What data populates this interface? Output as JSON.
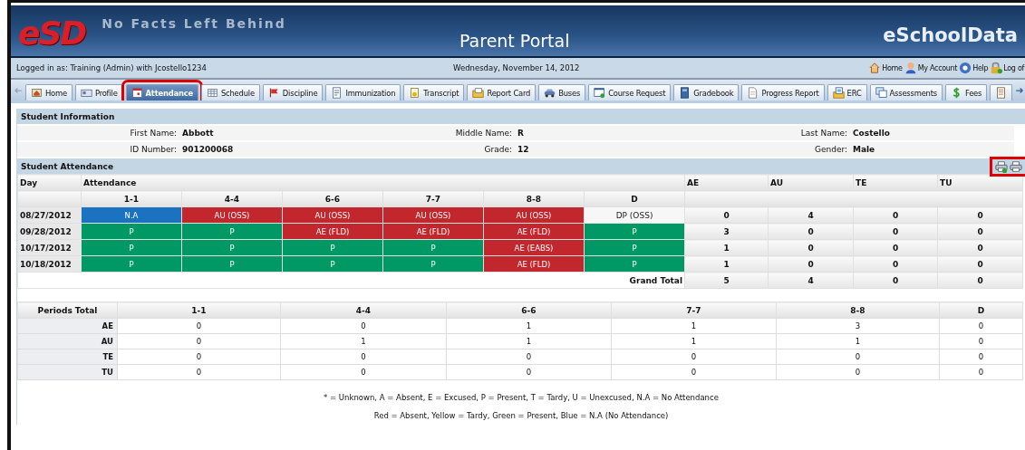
{
  "header": {
    "logo": "eSD",
    "tagline": "No Facts Left Behind",
    "title": "Parent Portal",
    "brand": "eSchoolData"
  },
  "info_bar": {
    "login": "Logged in as: Training (Admin) with Jcostello1234",
    "date": "Wednesday, November 14, 2012",
    "links": [
      "Home",
      "My Account",
      "Help",
      "Log of"
    ]
  },
  "tabs": [
    {
      "label": "Home",
      "selected": false,
      "highlighted": false
    },
    {
      "label": "Profile",
      "selected": false,
      "highlighted": false
    },
    {
      "label": "Attendance",
      "selected": true,
      "highlighted": true
    },
    {
      "label": "Schedule",
      "selected": false,
      "highlighted": false
    },
    {
      "label": "Discipline",
      "selected": false,
      "highlighted": false
    },
    {
      "label": "Immunization",
      "selected": false,
      "highlighted": false
    },
    {
      "label": "Transcript",
      "selected": false,
      "highlighted": false
    },
    {
      "label": "Report Card",
      "selected": false,
      "highlighted": false
    },
    {
      "label": "Buses",
      "selected": false,
      "highlighted": false
    },
    {
      "label": "Course Request",
      "selected": false,
      "highlighted": false
    },
    {
      "label": "Gradebook",
      "selected": false,
      "highlighted": false
    },
    {
      "label": "Progress Report",
      "selected": false,
      "highlighted": false
    },
    {
      "label": "ERC",
      "selected": false,
      "highlighted": false
    },
    {
      "label": "Assessments",
      "selected": false,
      "highlighted": false
    },
    {
      "label": "Fees",
      "selected": false,
      "highlighted": false
    },
    {
      "selected": false,
      "highlighted": false
    }
  ],
  "student_information": {
    "title": "Student Information",
    "fields": [
      {
        "label": "First Name:",
        "value": "Abbott"
      },
      {
        "label": "Middle Name:",
        "value": "R"
      },
      {
        "label": "Last Name:",
        "value": "Costello"
      },
      {
        "label": "ID Number:",
        "value": "901200068"
      },
      {
        "label": "Grade:",
        "value": "12"
      },
      {
        "label": "Gender:",
        "value": "Male"
      }
    ]
  },
  "student_attendance": {
    "title": "Student Attendance",
    "print_highlighted": true,
    "columns": {
      "day": "Day",
      "attendance": "Attendance",
      "periods": [
        "1-1",
        "4-4",
        "6-6",
        "7-7",
        "8-8",
        "D"
      ],
      "totals": [
        "AE",
        "AU",
        "TE",
        "TU"
      ]
    },
    "rows": [
      {
        "day": "08/27/2012",
        "cells": [
          {
            "text": "N.A",
            "color": "#1a72c0"
          },
          {
            "text": "AU (OSS)",
            "color": "#c1272d"
          },
          {
            "text": "AU (OSS)",
            "color": "#c1272d"
          },
          {
            "text": "AU (OSS)",
            "color": "#c1272d"
          },
          {
            "text": "AU (OSS)",
            "color": "#c1272d"
          },
          {
            "text": "DP (OSS)",
            "color": "#f7f7f7"
          }
        ],
        "totals": [
          "0",
          "4",
          "0",
          "0"
        ]
      },
      {
        "day": "09/28/2012",
        "cells": [
          {
            "text": "P",
            "color": "#009966"
          },
          {
            "text": "P",
            "color": "#009966"
          },
          {
            "text": "AE (FLD)",
            "color": "#c1272d"
          },
          {
            "text": "AE (FLD)",
            "color": "#c1272d"
          },
          {
            "text": "AE (FLD)",
            "color": "#c1272d"
          },
          {
            "text": "P",
            "color": "#009966"
          }
        ],
        "totals": [
          "3",
          "0",
          "0",
          "0"
        ]
      },
      {
        "day": "10/17/2012",
        "cells": [
          {
            "text": "P",
            "color": "#009966"
          },
          {
            "text": "P",
            "color": "#009966"
          },
          {
            "text": "P",
            "color": "#009966"
          },
          {
            "text": "P",
            "color": "#009966"
          },
          {
            "text": "AE (EABS)",
            "color": "#c1272d"
          },
          {
            "text": "P",
            "color": "#009966"
          }
        ],
        "totals": [
          "1",
          "0",
          "0",
          "0"
        ]
      },
      {
        "day": "10/18/2012",
        "cells": [
          {
            "text": "P",
            "color": "#009966"
          },
          {
            "text": "P",
            "color": "#009966"
          },
          {
            "text": "P",
            "color": "#009966"
          },
          {
            "text": "P",
            "color": "#009966"
          },
          {
            "text": "AE (FLD)",
            "color": "#c1272d"
          },
          {
            "text": "P",
            "color": "#009966"
          }
        ],
        "totals": [
          "1",
          "0",
          "0",
          "0"
        ]
      }
    ],
    "grand_total": {
      "label": "Grand Total",
      "values": [
        "5",
        "4",
        "0",
        "0"
      ]
    }
  },
  "periods_total": {
    "title": "Periods Total",
    "columns": [
      "1-1",
      "4-4",
      "6-6",
      "7-7",
      "8-8",
      "D"
    ],
    "rows": [
      {
        "label": "AE",
        "values": [
          "0",
          "0",
          "1",
          "1",
          "3",
          "0"
        ]
      },
      {
        "label": "AU",
        "values": [
          "0",
          "1",
          "1",
          "1",
          "1",
          "0"
        ]
      },
      {
        "label": "TE",
        "values": [
          "0",
          "0",
          "0",
          "0",
          "0",
          "0"
        ]
      },
      {
        "label": "TU",
        "values": [
          "0",
          "0",
          "0",
          "0",
          "0",
          "0"
        ]
      }
    ]
  },
  "legend": [
    "* = Unknown, A = Absent, E = Excused, P = Present, T = Tardy, U = Unexcused, N.A = No Attendance",
    "Red = Absent, Yellow = Tardy, Green = Present, Blue = N.A (No Attendance)"
  ]
}
